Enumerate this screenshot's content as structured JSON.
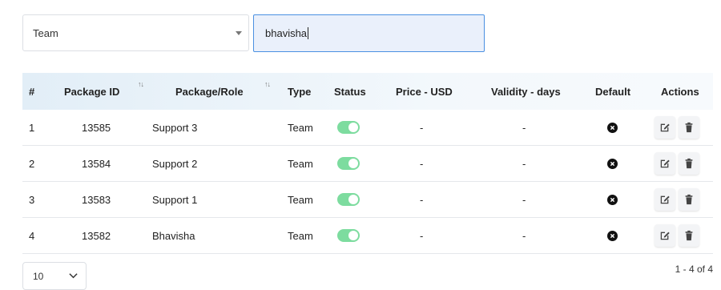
{
  "filters": {
    "role_type": {
      "value": "Team"
    },
    "search": {
      "value": "bhavisha"
    }
  },
  "table": {
    "headers": [
      "#",
      "Package ID",
      "Package/Role",
      "Type",
      "Status",
      "Price - USD",
      "Validity - days",
      "Default",
      "Actions"
    ],
    "rows": [
      {
        "num": "1",
        "package_id": "13585",
        "role": "Support 3",
        "type": "Team",
        "status": true,
        "price": "-",
        "validity": "-"
      },
      {
        "num": "2",
        "package_id": "13584",
        "role": "Support 2",
        "type": "Team",
        "status": true,
        "price": "-",
        "validity": "-"
      },
      {
        "num": "3",
        "package_id": "13583",
        "role": "Support 1",
        "type": "Team",
        "status": true,
        "price": "-",
        "validity": "-"
      },
      {
        "num": "4",
        "package_id": "13582",
        "role": "Bhavisha",
        "type": "Team",
        "status": true,
        "price": "-",
        "validity": "-"
      }
    ]
  },
  "pagination": {
    "page_size": "10",
    "range": "1 - 4 of 4"
  },
  "colors": {
    "toggle_on": "#7ddc9f",
    "focus_border": "#4a90e2",
    "header_bg": "#eaf1f8"
  },
  "icons": {
    "sort": "sort-arrows-icon",
    "default": "x-circle-icon",
    "edit": "edit-icon",
    "delete": "trash-icon",
    "dropdown": "chevron-down-icon"
  }
}
